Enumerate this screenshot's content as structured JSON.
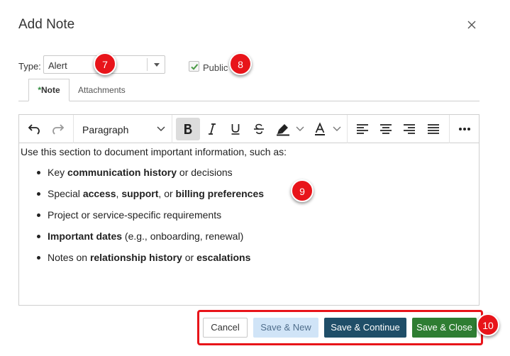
{
  "dialog": {
    "title": "Add Note"
  },
  "form": {
    "type_label": "Type:",
    "type_value": "Alert",
    "public_label": "Public",
    "public_checked": true
  },
  "tabs": [
    {
      "label": "Note",
      "required": true,
      "required_marker": "*",
      "active": true
    },
    {
      "label": "Attachments",
      "active": false
    }
  ],
  "toolbar": {
    "paragraph_label": "Paragraph",
    "icons": [
      "undo-icon",
      "redo-icon",
      "bold-icon",
      "italic-icon",
      "underline-icon",
      "strikethrough-icon",
      "highlight-icon",
      "font-color-icon",
      "align-left-icon",
      "align-center-icon",
      "align-right-icon",
      "justify-icon",
      "more-icon"
    ]
  },
  "content": {
    "intro": "Use this section to document important information, such as:",
    "bullets": [
      [
        {
          "t": "Key ",
          "b": false
        },
        {
          "t": "communication history",
          "b": true
        },
        {
          "t": " or decisions",
          "b": false
        }
      ],
      [
        {
          "t": "Special ",
          "b": false
        },
        {
          "t": "access",
          "b": true
        },
        {
          "t": ", ",
          "b": false
        },
        {
          "t": "support",
          "b": true
        },
        {
          "t": ", or ",
          "b": false
        },
        {
          "t": "billing preferences",
          "b": true
        }
      ],
      [
        {
          "t": "Project or service-specific requirements",
          "b": false
        }
      ],
      [
        {
          "t": "Important dates",
          "b": true
        },
        {
          "t": " (e.g., onboarding, renewal)",
          "b": false
        }
      ],
      [
        {
          "t": "Notes on ",
          "b": false
        },
        {
          "t": "relationship history",
          "b": true
        },
        {
          "t": " or ",
          "b": false
        },
        {
          "t": "escalations",
          "b": true
        }
      ]
    ]
  },
  "buttons": {
    "cancel": "Cancel",
    "save_new": "Save & New",
    "save_continue": "Save & Continue",
    "save_close": "Save & Close"
  },
  "callouts": {
    "type": "7",
    "public": "8",
    "editor": "9",
    "buttons": "10"
  },
  "colors": {
    "callout_red": "#e8141a",
    "save_continue_bg": "#1f4e68",
    "save_close_bg": "#2e7d32",
    "save_new_bg": "#d0e4f7",
    "required_marker": "#2e8b3d"
  }
}
